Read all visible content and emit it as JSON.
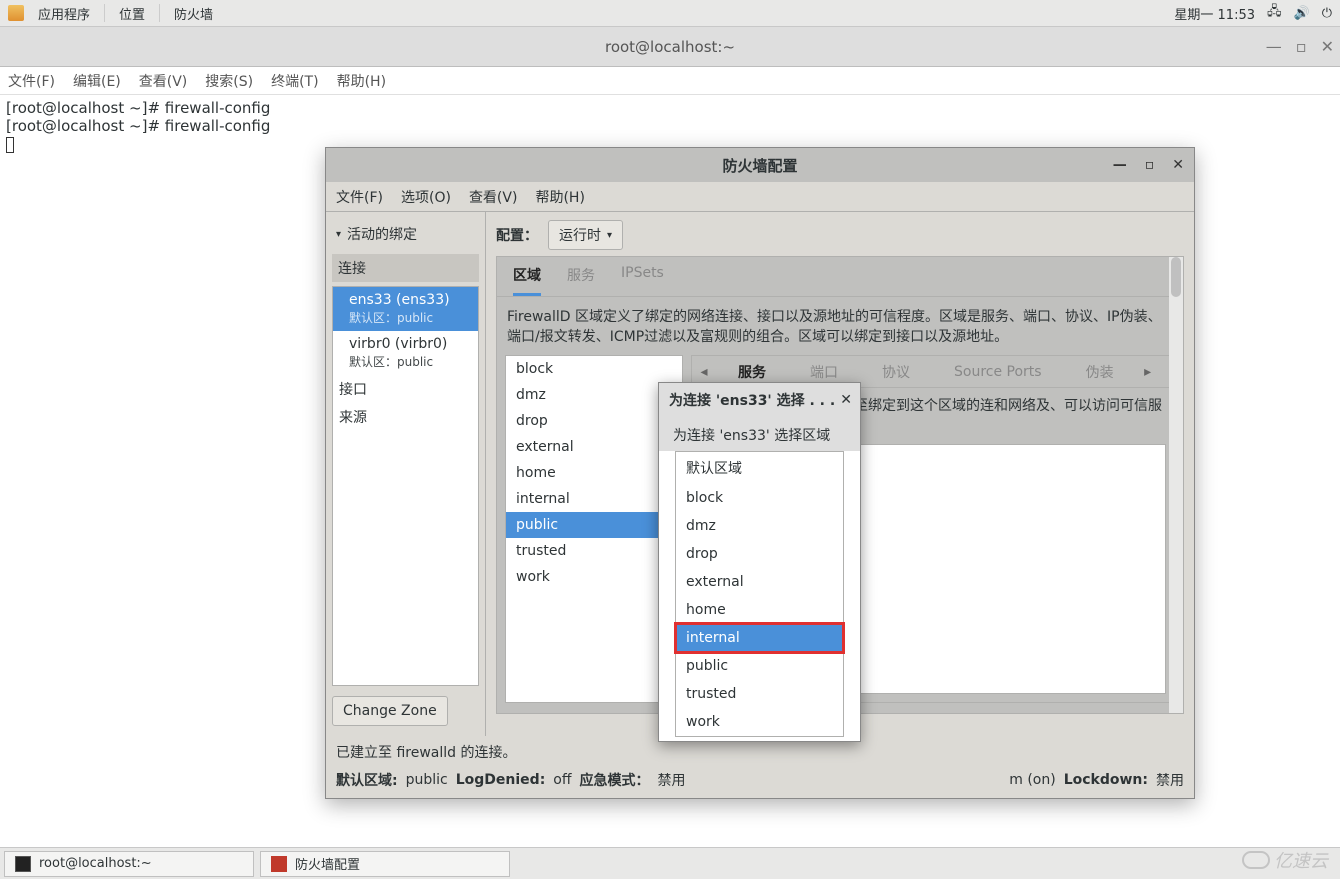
{
  "top_panel": {
    "apps": "应用程序",
    "places": "位置",
    "firewall": "防火墙",
    "clock": "星期一 11:53"
  },
  "terminal": {
    "title": "root@localhost:~",
    "menus": {
      "file": "文件(F)",
      "edit": "编辑(E)",
      "view": "查看(V)",
      "search": "搜索(S)",
      "terminal": "终端(T)",
      "help": "帮助(H)"
    },
    "lines": [
      "[root@localhost ~]# firewall-config",
      "[root@localhost ~]# firewall-config"
    ]
  },
  "firewall": {
    "title": "防火墙配置",
    "menus": {
      "file": "文件(F)",
      "options": "选项(O)",
      "view": "查看(V)",
      "help": "帮助(H)"
    },
    "panel_toggle": "活动的绑定",
    "connections_header": "连接",
    "connections": [
      {
        "name": "ens33 (ens33)",
        "default_label": "默认区：public",
        "selected": true
      },
      {
        "name": "virbr0 (virbr0)",
        "default_label": "默认区：public",
        "selected": false
      }
    ],
    "interface_label": "接口",
    "source_label": "来源",
    "change_zone": "Change Zone",
    "config_label": "配置：",
    "config_value": "运行时",
    "outer_tabs": {
      "zone": "区域",
      "service": "服务",
      "ipsets": "IPSets"
    },
    "zone_desc": "FirewallD 区域定义了绑定的网络连接、接口以及源地址的可信程度。区域是服务、端口、协议、IP伪装、端口/报文转发、ICMP过滤以及富规则的组合。区域可以绑定到接口以及源地址。",
    "zones": [
      "block",
      "dmz",
      "drop",
      "external",
      "home",
      "internal",
      "public",
      "trusted",
      "work"
    ],
    "zone_selected": "public",
    "inner_tabs": {
      "service": "服务",
      "port": "端口",
      "protocol": "协议",
      "source_ports": "Source Ports",
      "masq": "伪装"
    },
    "service_desc": "些服务是可信的。可连接至绑定到这个区域的连和网络及、可以访问可信服务。",
    "conn_status": "已建立至 firewalld 的连接。",
    "status": {
      "default_zone_label": "默认区域:",
      "default_zone_value": "public",
      "log_denied_label": "LogDenied:",
      "log_denied_value": "off",
      "panic_label": "应急模式：",
      "panic_value": "禁用",
      "auto_helpers": "m (on)",
      "lockdown_label": "Lockdown:",
      "lockdown_value": "禁用"
    }
  },
  "zone_popup": {
    "title": "为连接 'ens33' 选择 . . .",
    "label": "为连接 'ens33' 选择区域",
    "default_zone": "默认区域",
    "options": [
      "block",
      "dmz",
      "drop",
      "external",
      "home",
      "internal",
      "public",
      "trusted",
      "work"
    ],
    "selected": "internal"
  },
  "taskbar": {
    "term": "root@localhost:~",
    "fw": "防火墙配置"
  },
  "watermark": "亿速云"
}
